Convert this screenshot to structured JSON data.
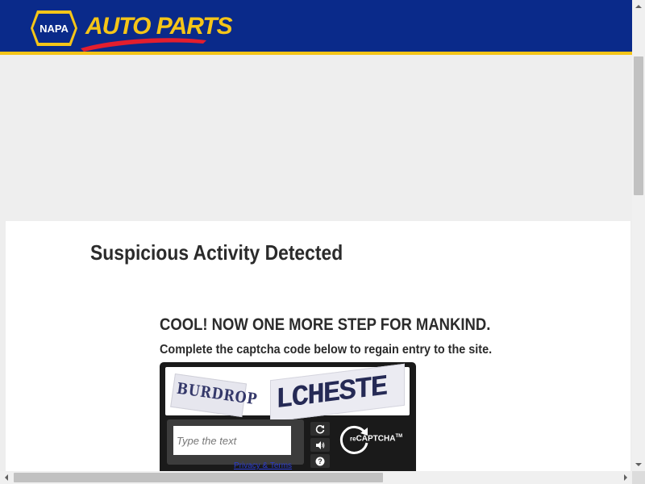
{
  "header": {
    "logo_text": "NAPA",
    "brand_text": "AUTO PARTS",
    "colors": {
      "background": "#0a2a8a",
      "accent": "#f5c518",
      "swoosh": "#e31e2e"
    }
  },
  "main": {
    "title": "Suspicious Activity Detected",
    "step_heading": "COOL! NOW ONE MORE STEP FOR MANKIND.",
    "instruction": "Complete the captcha code below to regain entry to the site."
  },
  "captcha": {
    "word1": "BURDROP",
    "word2": "LCHESTE",
    "input_placeholder": "Type the text",
    "input_value": "",
    "logo_prefix": "re",
    "logo_text": "CAPTCHA",
    "trademark": "TM",
    "privacy_link": "Privacy & Terms",
    "controls": {
      "reload": "refresh-icon",
      "audio": "audio-icon",
      "help": "help-icon"
    }
  },
  "scrollbars": {
    "vertical_arrows": [
      "arrow-up-icon",
      "arrow-down-icon"
    ],
    "horizontal_arrows": [
      "arrow-left-icon",
      "arrow-right-icon"
    ]
  }
}
